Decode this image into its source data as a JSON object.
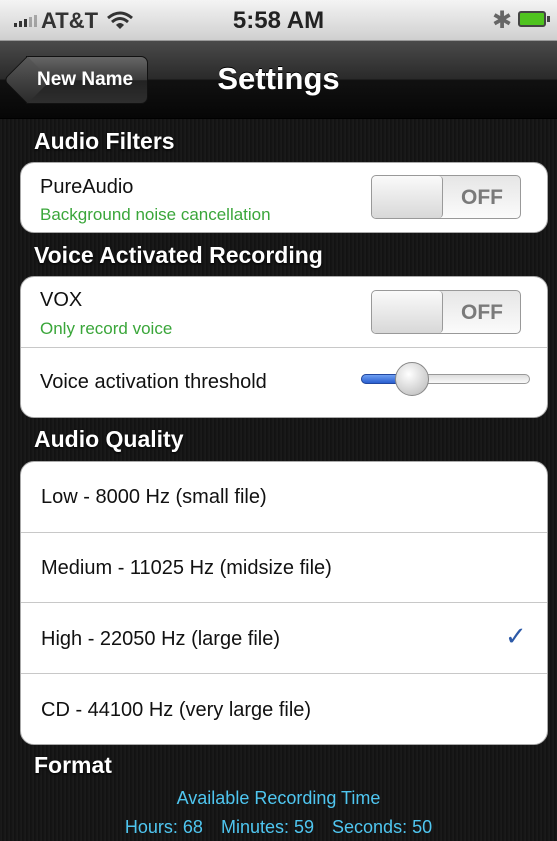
{
  "status_bar": {
    "carrier": "AT&T",
    "time": "5:58 AM"
  },
  "nav": {
    "back_label": "New Name",
    "title": "Settings"
  },
  "audio_filters": {
    "header": "Audio Filters",
    "pureaudio": {
      "label": "PureAudio",
      "subtitle": "Background noise cancellation",
      "toggle": "OFF"
    }
  },
  "voice_activated": {
    "header": "Voice Activated Recording",
    "vox": {
      "label": "VOX",
      "subtitle": "Only record voice",
      "toggle": "OFF"
    },
    "threshold": {
      "label": "Voice activation threshold",
      "value": 0.3
    }
  },
  "audio_quality": {
    "header": "Audio Quality",
    "options": [
      {
        "label": "Low - 8000 Hz (small file)",
        "selected": false
      },
      {
        "label": "Medium - 11025 Hz (midsize file)",
        "selected": false
      },
      {
        "label": "High - 22050 Hz (large file)",
        "selected": true
      },
      {
        "label": "CD - 44100 Hz (very large file)",
        "selected": false
      }
    ],
    "checkmark": "✓"
  },
  "format": {
    "header": "Format",
    "available_title": "Available Recording Time",
    "hours": "Hours: 68",
    "minutes": "Minutes: 59",
    "seconds": "Seconds: 50"
  },
  "icons": {
    "bluetooth": "bluetooth-icon",
    "battery": "battery-icon",
    "signal": "signal-bars-icon",
    "wifi": "wifi-icon",
    "check": "checkmark-icon"
  },
  "colors": {
    "accent_blue": "#2d5aa8",
    "subtitle_green": "#3aa63a",
    "info_cyan": "#4fc6f0",
    "battery_green": "#4fc31f"
  }
}
